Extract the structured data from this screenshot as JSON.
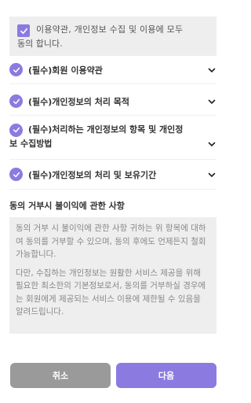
{
  "agree_all": {
    "line1": "이용약관, 개인정보 수집 및 이용에 모두",
    "line2": "동의 합니다.",
    "checked": true
  },
  "terms": [
    {
      "label": "(필수)회원 이용약관",
      "checked": true
    },
    {
      "label": "(필수)개인정보의 처리 목적",
      "checked": true
    },
    {
      "label_line1": "(필수)처리하는 개인정보의 항목 및 개인정",
      "label_line2": "보 수집방법",
      "checked": true
    },
    {
      "label": "(필수)개인정보의 처리 및 보유기간",
      "checked": true
    }
  ],
  "section": {
    "title": "동의 거부시 불이익에 관한 사항",
    "paragraph1": "동의 거부 시 불이익에 관한 사항 귀하는 위 항목에 대하여 동의를 거부할 수 있으며, 동의 후에도 언제든지 철회 가능합니다.",
    "paragraph2": "다만, 수집하는 개인정보는 원활한 서비스 제공을 위해 필요한 최소한의 기본정보로서, 동의를 거부하실 경우에는 회원에게 제공되는 서비스 이용에 제한될 수 있음을 알려드립니다."
  },
  "buttons": {
    "cancel": "취소",
    "next": "다음"
  },
  "colors": {
    "accent": "#8b7be0",
    "cancel": "#9a9a9a",
    "panel": "#eeeeee"
  }
}
